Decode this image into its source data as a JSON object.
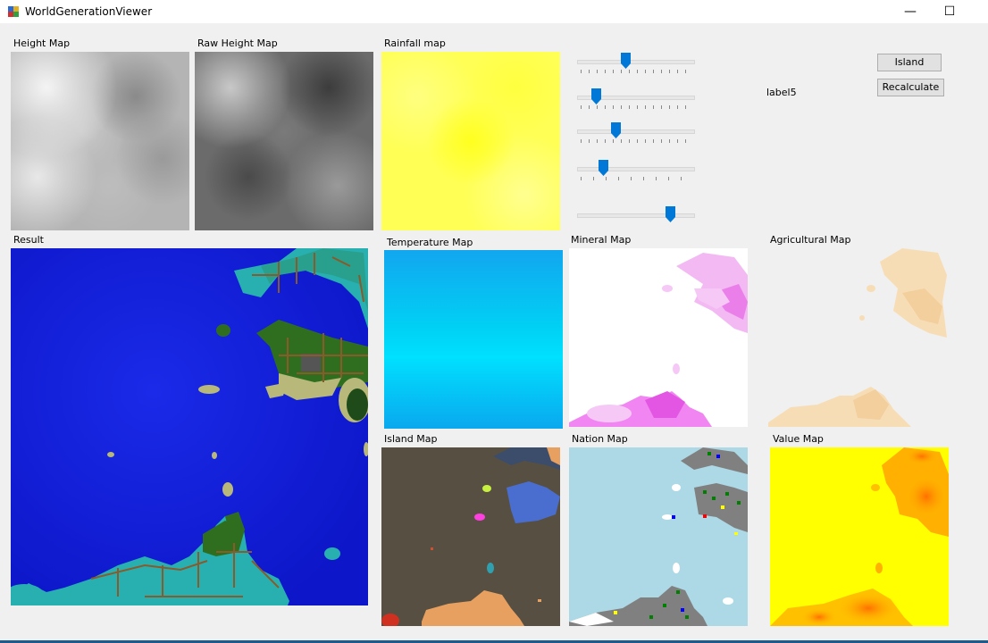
{
  "window": {
    "title": "WorldGenerationViewer",
    "minimize": "—",
    "maximize": "☐",
    "close": "✕"
  },
  "labels": {
    "height_map": "Height Map",
    "raw_height_map": "Raw Height Map",
    "rainfall_map": "Rainfall map",
    "result": "Result",
    "temperature_map": "Temperature Map",
    "mineral_map": "Mineral Map",
    "agricultural_map": "Agricultural Map",
    "island_map": "Island Map",
    "nation_map": "Nation Map",
    "value_map": "Value Map",
    "label5": "label5"
  },
  "buttons": {
    "island": "Island",
    "recalculate": "Recalculate"
  },
  "sliders": [
    {
      "value_fraction": 0.42,
      "ticks": "dense"
    },
    {
      "value_fraction": 0.14,
      "ticks": "dense"
    },
    {
      "value_fraction": 0.33,
      "ticks": "dense"
    },
    {
      "value_fraction": 0.22,
      "ticks": "sparse"
    },
    {
      "value_fraction": 0.82,
      "ticks": "none"
    }
  ],
  "colors": {
    "window_bg": "#f0f0f0",
    "slider_thumb": "#0078d7",
    "ocean": "#1111dd",
    "land_green": "#2f6e1f",
    "shallow": "#28b0b0",
    "sand": "#b8b87a",
    "road": "#8a5a2a",
    "rainfall": "#ffff33",
    "temperature": "#00d0ff",
    "mineral": "#ee66ee",
    "agricultural": "#f5d9b0",
    "island_bg": "#575042",
    "nation_bg": "#add8e6",
    "nation_land": "#808080",
    "value_bg": "#ffff00",
    "value_hot": "#ff8800"
  },
  "icons": {
    "app": "world-generation-app-icon"
  }
}
